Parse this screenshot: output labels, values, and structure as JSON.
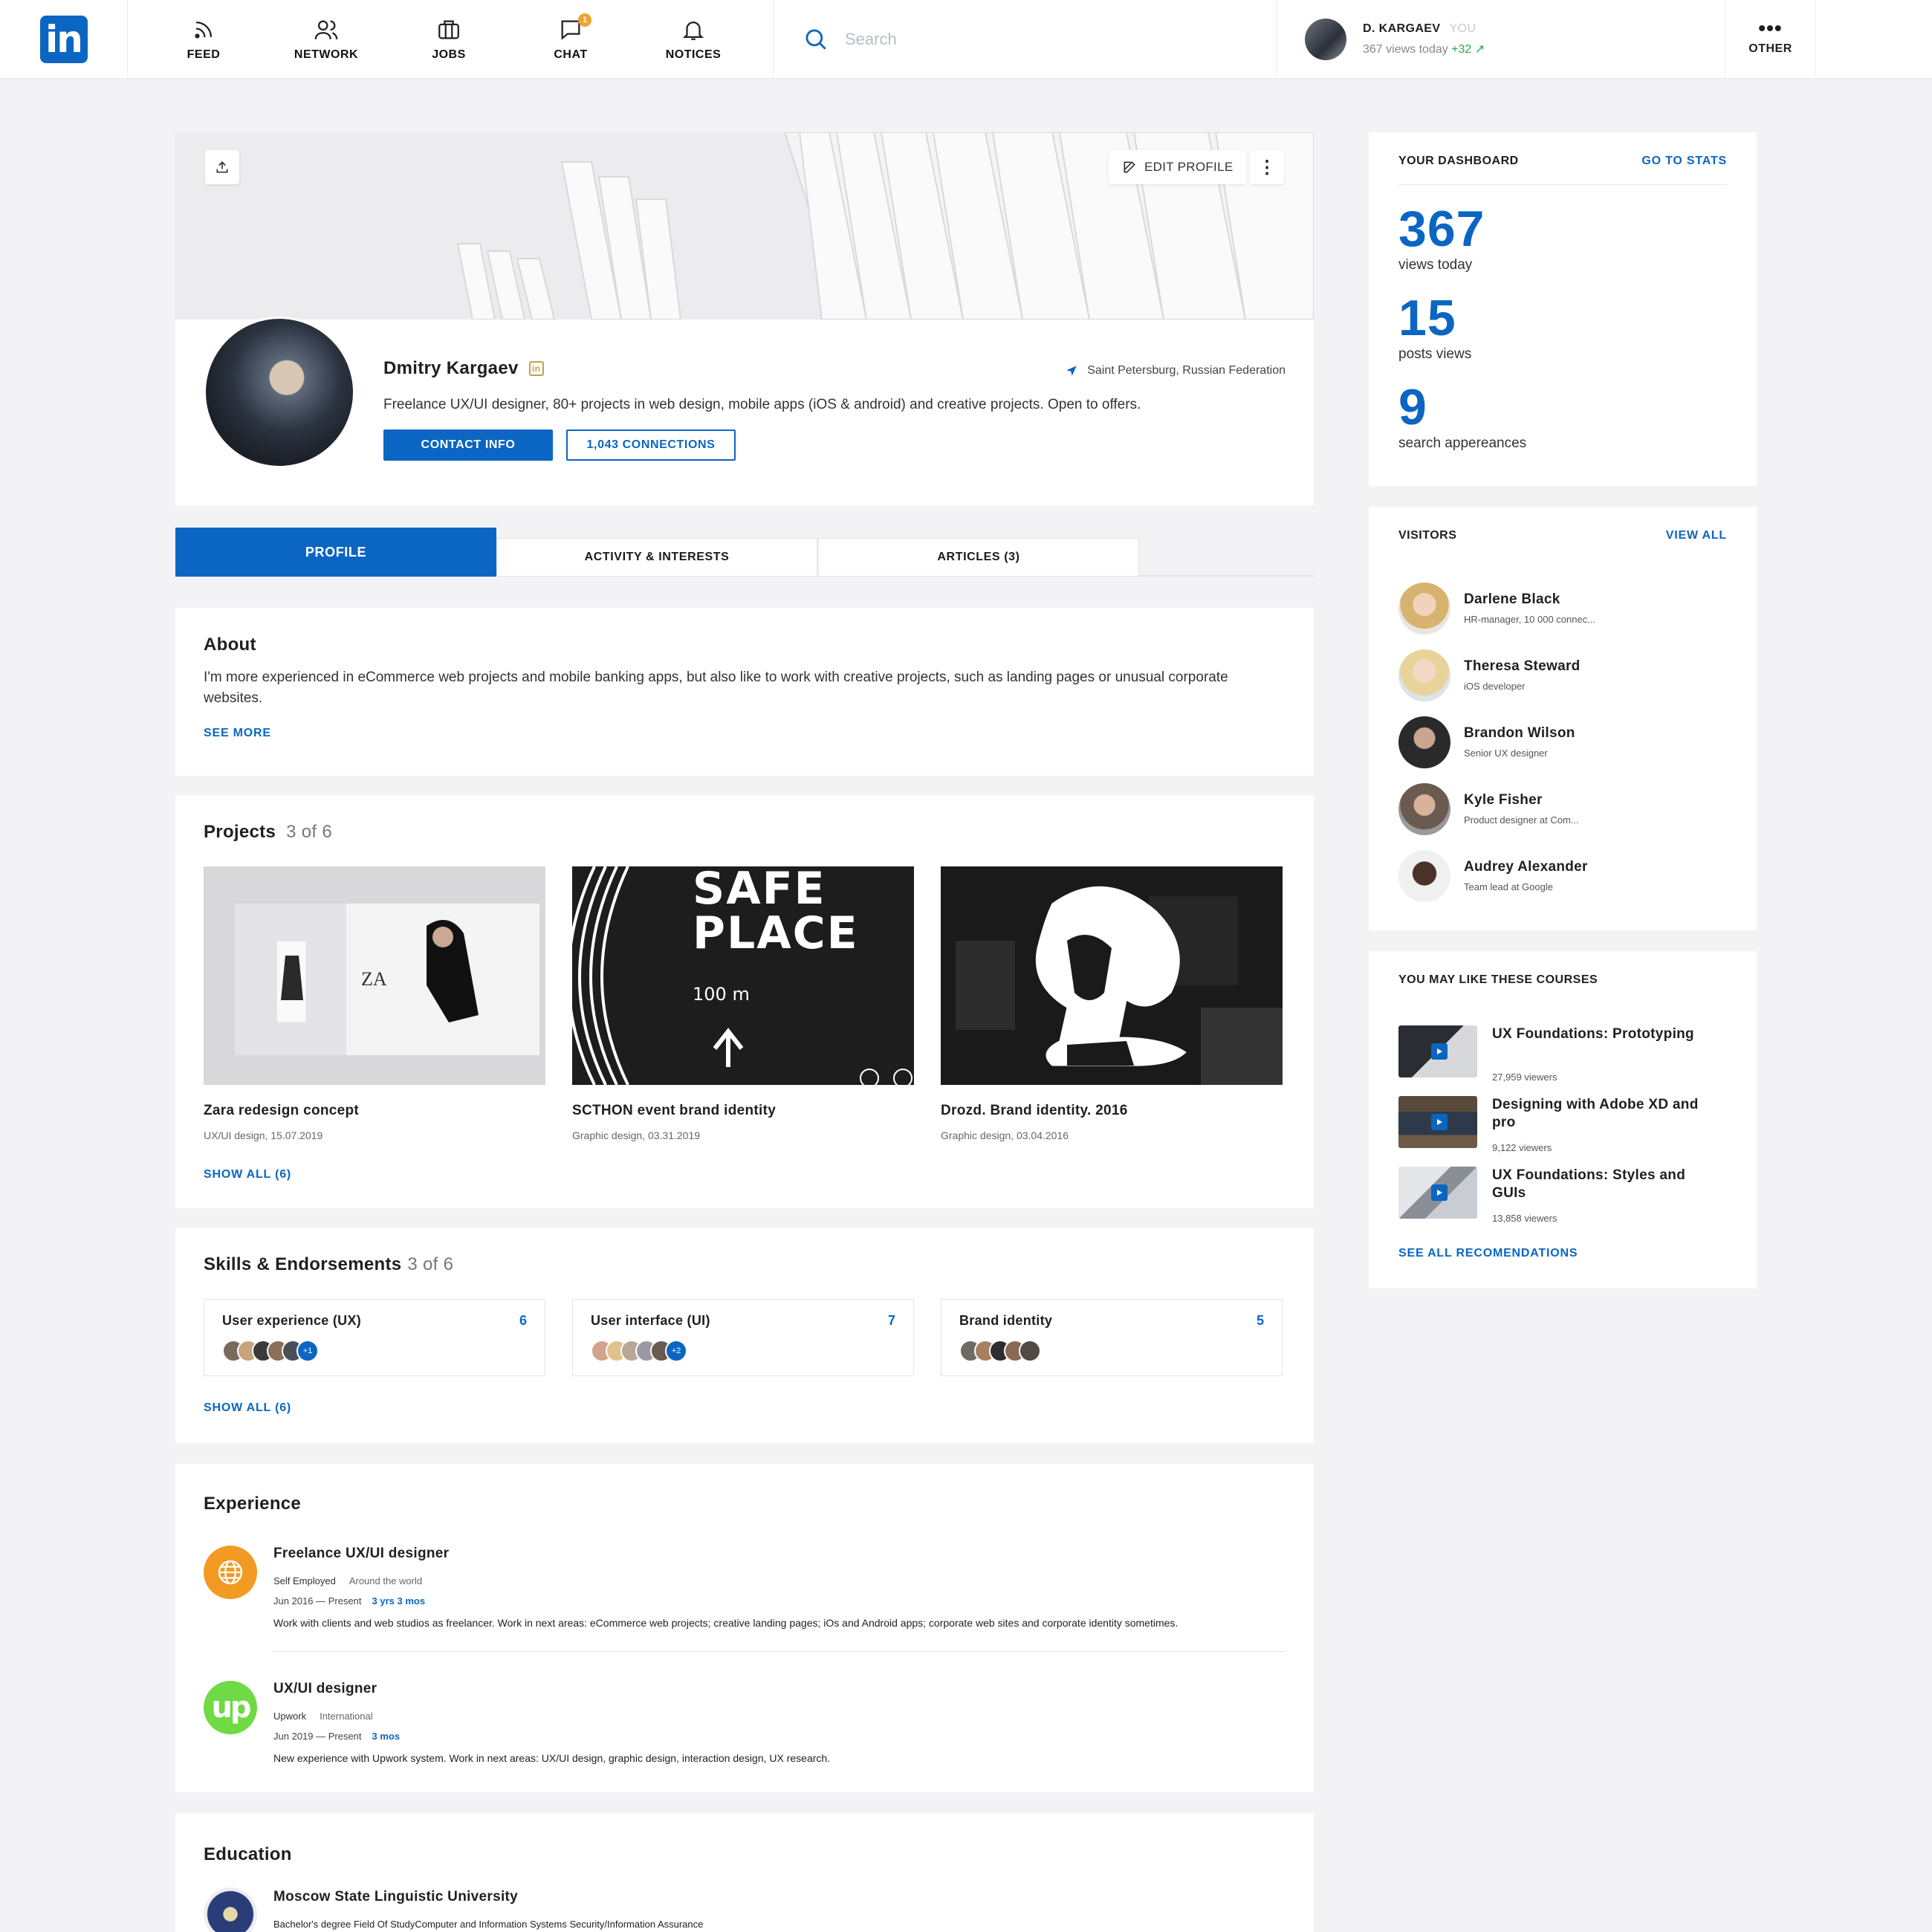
{
  "nav": {
    "logo": "in",
    "items": [
      {
        "label": "FEED",
        "icon": "rss-icon"
      },
      {
        "label": "NETWORK",
        "icon": "users-icon"
      },
      {
        "label": "JOBS",
        "icon": "briefcase-icon"
      },
      {
        "label": "CHAT",
        "icon": "chat-icon",
        "badge": "1"
      },
      {
        "label": "NOTICES",
        "icon": "bell-icon"
      }
    ],
    "search_placeholder": "Search",
    "user": {
      "name": "D. KARGAEV",
      "you": "YOU",
      "views": "367 views today",
      "delta": "+32"
    },
    "other": "OTHER"
  },
  "profile": {
    "edit": "EDIT PROFILE",
    "name": "Dmitry Kargaev",
    "location": "Saint Petersburg, Russian Federation",
    "headline": "Freelance UX/UI designer, 80+ projects in web design, mobile apps (iOS & android) and creative projects. Open to offers.",
    "contact": "CONTACT INFO",
    "connections": "1,043 CONNECTIONS"
  },
  "tabs": [
    "PROFILE",
    "ACTIVITY & INTERESTS",
    "ARTICLES (3)"
  ],
  "about": {
    "title": "About",
    "text": "I'm more experienced in eCommerce web projects and mobile banking apps, but also like to work with creative projects, such as landing pages or unusual corporate websites.",
    "more": "SEE MORE"
  },
  "projects": {
    "title": "Projects",
    "count": "3 of 6",
    "items": [
      {
        "title": "Zara redesign concept",
        "sub": "UX/UI design, 15.07.2019"
      },
      {
        "title": "SCTHON event brand identity",
        "sub": "Graphic design, 03.31.2019",
        "art_text_1": "SAFE",
        "art_text_2": "PLACE",
        "art_text_3": "100 m"
      },
      {
        "title": "Drozd. Brand identity. 2016",
        "sub": "Graphic design, 03.04.2016"
      }
    ],
    "show_all": "SHOW ALL (6)"
  },
  "skills": {
    "title": "Skills & Endorsements",
    "count": "3 of 6",
    "items": [
      {
        "name": "User experience (UX)",
        "num": "6",
        "plus": "+1"
      },
      {
        "name": "User interface (UI)",
        "num": "7",
        "plus": "+2"
      },
      {
        "name": "Brand identity",
        "num": "5"
      }
    ],
    "show_all": "SHOW ALL (6)"
  },
  "experience": {
    "title": "Experience",
    "items": [
      {
        "title": "Freelance UX/UI designer",
        "company": "Self Employed",
        "place": "Around the world",
        "dates": "Jun 2016 — Present",
        "duration": "3 yrs 3 mos",
        "desc": "Work with clients and web studios as freelancer. Work in next areas: eCommerce web projects; creative landing pages; iOs and Android apps; corporate web sites and corporate identity sometimes."
      },
      {
        "title": "UX/UI designer",
        "company": "Upwork",
        "place": "International",
        "dates": "Jun 2019 — Present",
        "duration": "3 mos",
        "desc": "New experience with Upwork system. Work in next areas: UX/UI design, graphic design, interaction design, UX research."
      }
    ]
  },
  "education": {
    "title": "Education",
    "school": "Moscow State Linguistic University",
    "degree": "Bachelor's degree Field Of StudyComputer and Information Systems Security/Information Assurance"
  },
  "dashboard": {
    "title": "YOUR DASHBOARD",
    "link": "GO TO STATS",
    "stats": [
      {
        "num": "367",
        "label": "views today"
      },
      {
        "num": "15",
        "label": "posts views"
      },
      {
        "num": "9",
        "label": "search appereances"
      }
    ]
  },
  "visitors": {
    "title": "VISITORS",
    "link": "VIEW ALL",
    "items": [
      {
        "name": "Darlene Black",
        "sub": "HR-manager, 10 000 connec..."
      },
      {
        "name": "Theresa Steward",
        "sub": "iOS developer"
      },
      {
        "name": "Brandon Wilson",
        "sub": "Senior UX designer"
      },
      {
        "name": "Kyle Fisher",
        "sub": "Product designer at Com..."
      },
      {
        "name": "Audrey Alexander",
        "sub": "Team lead at Google"
      }
    ]
  },
  "courses": {
    "title": "YOU MAY LIKE THESE COURSES",
    "items": [
      {
        "title": "UX Foundations: Prototyping",
        "viewers": "27,959 viewers"
      },
      {
        "title": "Designing with Adobe XD and pro",
        "viewers": "9,122 viewers"
      },
      {
        "title": "UX Foundations: Styles and GUIs",
        "viewers": "13,858 viewers"
      }
    ],
    "link": "SEE ALL RECOMENDATIONS"
  },
  "colors": {
    "accent": "#0a66c2",
    "badge": "#f0a330",
    "positive": "#2ba84a"
  }
}
